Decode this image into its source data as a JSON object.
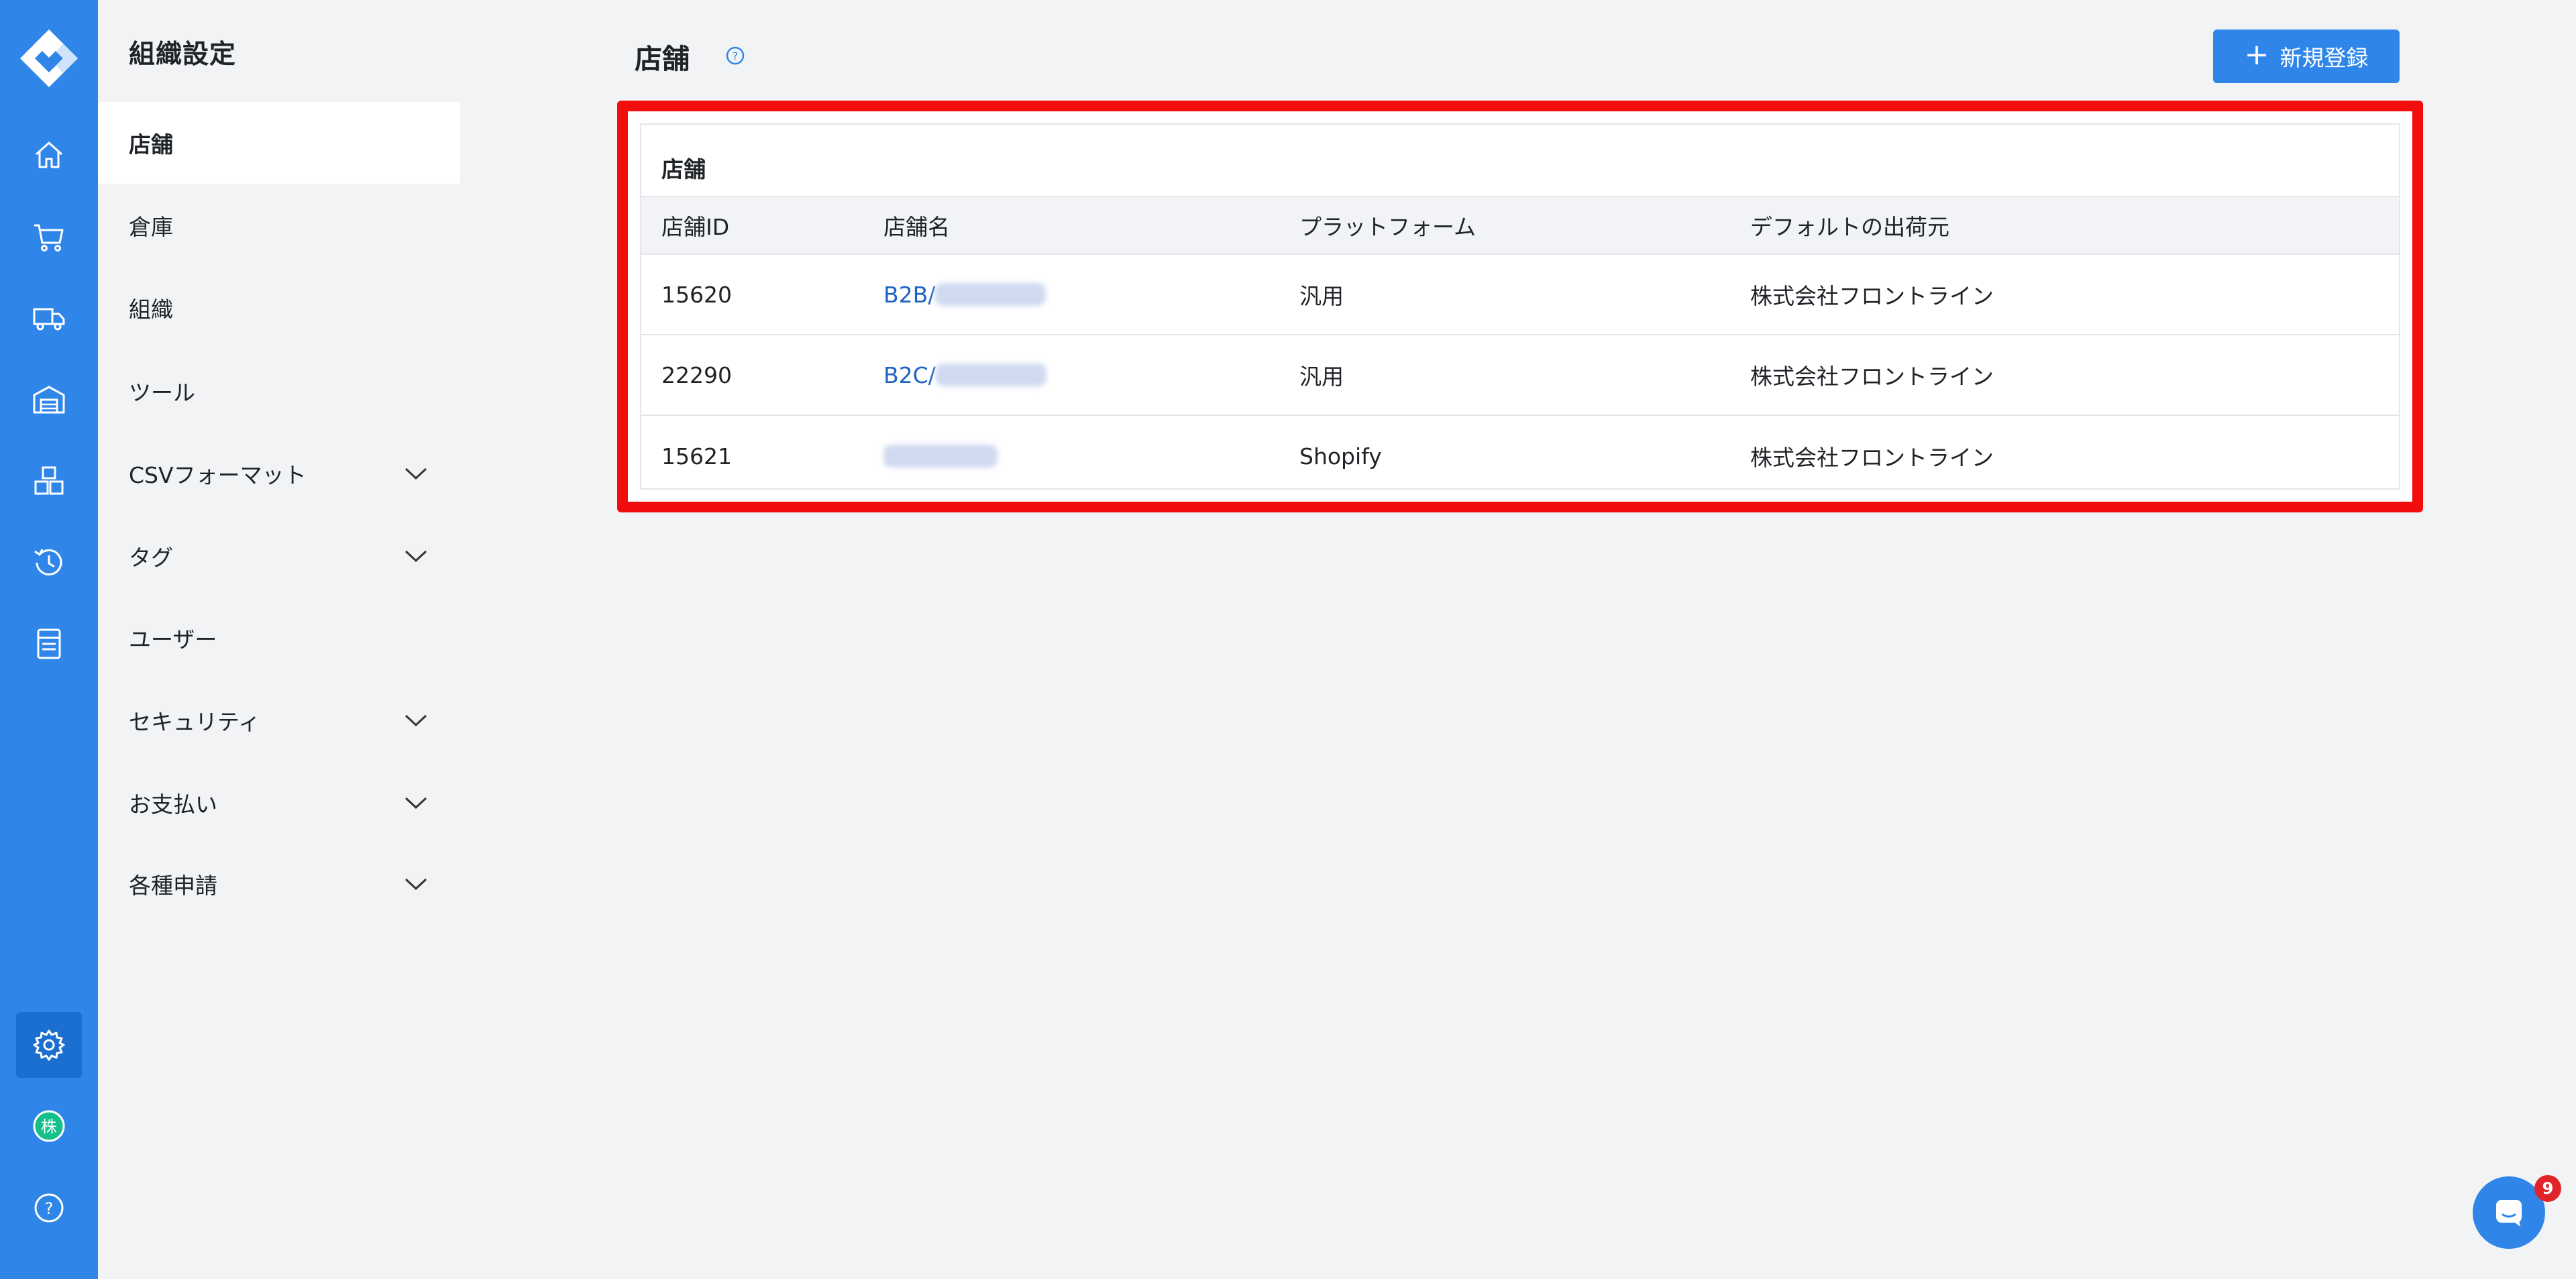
{
  "rail": {
    "items": [
      {
        "name": "home-icon"
      },
      {
        "name": "cart-icon"
      },
      {
        "name": "truck-icon"
      },
      {
        "name": "warehouse-icon"
      },
      {
        "name": "boxes-icon"
      },
      {
        "name": "history-icon"
      },
      {
        "name": "document-icon"
      },
      {
        "name": "settings-icon",
        "active": true
      },
      {
        "name": "organization-avatar-icon"
      },
      {
        "name": "help-icon"
      }
    ],
    "avatar_char": "株",
    "help_char": "?"
  },
  "sidebar": {
    "title": "組織設定",
    "items": [
      {
        "label": "店舗",
        "active": true
      },
      {
        "label": "倉庫"
      },
      {
        "label": "組織"
      },
      {
        "label": "ツール"
      },
      {
        "label": "CSVフォーマット",
        "expandable": true
      },
      {
        "label": "タグ",
        "expandable": true
      },
      {
        "label": "ユーザー"
      },
      {
        "label": "セキュリティ",
        "expandable": true
      },
      {
        "label": "お支払い",
        "expandable": true
      },
      {
        "label": "各種申請",
        "expandable": true
      }
    ]
  },
  "header": {
    "title": "店舗",
    "new_button_label": "新規登録",
    "plus": "+"
  },
  "card": {
    "title": "店舗",
    "columns": [
      "店舗ID",
      "店舗名",
      "プラットフォーム",
      "デフォルトの出荷元"
    ],
    "rows": [
      {
        "id": "15620",
        "name_prefix": "B2B/",
        "platform": "汎用",
        "origin": "株式会社フロントライン"
      },
      {
        "id": "22290",
        "name_prefix": "B2C/",
        "platform": "汎用",
        "origin": "株式会社フロントライン"
      },
      {
        "id": "15621",
        "name_prefix": "",
        "platform": "Shopify",
        "origin": "株式会社フロントライン"
      }
    ]
  },
  "chat": {
    "badge": "9"
  },
  "colors": {
    "brand_blue": "#2f86e8",
    "highlight_red": "#f20d0d",
    "link_blue": "#1e63c4",
    "badge_red": "#e0242a"
  }
}
